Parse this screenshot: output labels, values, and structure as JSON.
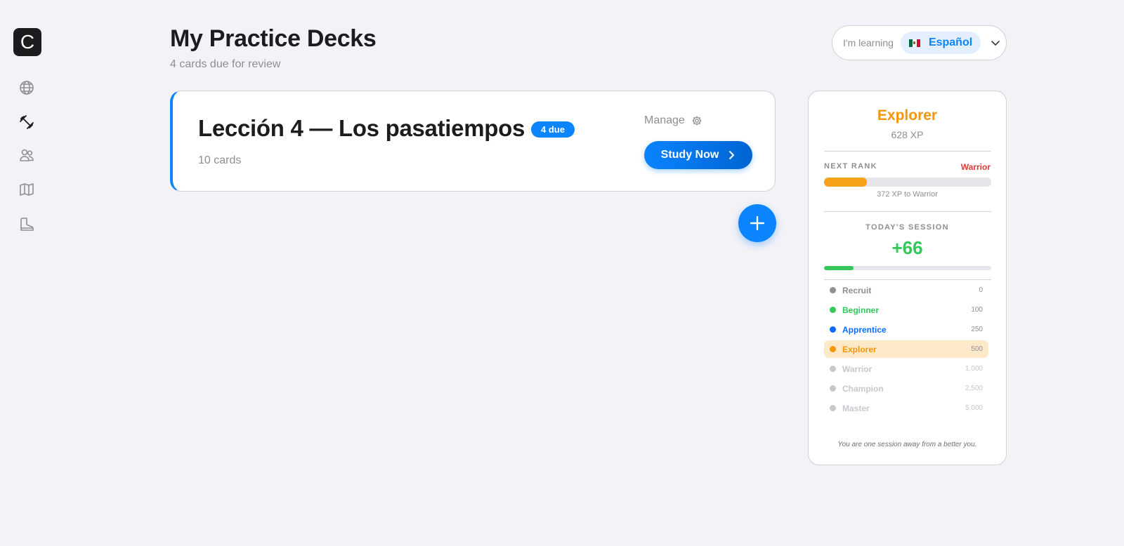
{
  "app": {
    "logo_letter": "C"
  },
  "sidebar": {
    "items": [
      {
        "name": "globe-icon",
        "active": false
      },
      {
        "name": "dumbbell-icon",
        "active": true
      },
      {
        "name": "users-icon",
        "active": false
      },
      {
        "name": "map-icon",
        "active": false
      },
      {
        "name": "boot-icon",
        "active": false
      }
    ]
  },
  "header": {
    "title": "My Practice Decks",
    "subtitle": "4 cards due for review"
  },
  "language": {
    "label": "I'm learning",
    "selected": "Español",
    "flag_icon": "mexico-flag-icon"
  },
  "deck": {
    "title": "Lección 4 — Los pasatiempos",
    "due_badge": "4 due",
    "card_count": "10 cards",
    "manage_label": "Manage",
    "study_label": "Study Now"
  },
  "rank_panel": {
    "current_rank": "Explorer",
    "xp": "628 XP",
    "next_rank_label": "NEXT RANK",
    "next_rank_name": "Warrior",
    "next_rank_progress": 0.256,
    "xp_to_next": "372 XP to Warrior",
    "session_label": "TODAY'S SESSION",
    "session_value": "+66",
    "session_progress": 0.176,
    "ranks": [
      {
        "name": "Recruit",
        "xp": "0",
        "color": "#8e8e93",
        "state": "achieved"
      },
      {
        "name": "Beginner",
        "xp": "100",
        "color": "#34c759",
        "state": "achieved"
      },
      {
        "name": "Apprentice",
        "xp": "250",
        "color": "#0a6cff",
        "state": "achieved"
      },
      {
        "name": "Explorer",
        "xp": "500",
        "color": "#f5960a",
        "state": "current"
      },
      {
        "name": "Warrior",
        "xp": "1,000",
        "color": "#c7c7cc",
        "state": "locked"
      },
      {
        "name": "Champion",
        "xp": "2,500",
        "color": "#c7c7cc",
        "state": "locked"
      },
      {
        "name": "Master",
        "xp": "5,000",
        "color": "#c7c7cc",
        "state": "locked"
      }
    ],
    "motto": "You are one session away from a better you."
  },
  "colors": {
    "accent": "#0a84ff",
    "rank_orange": "#f5960a",
    "warrior_red": "#e53935",
    "session_green": "#34c759"
  }
}
